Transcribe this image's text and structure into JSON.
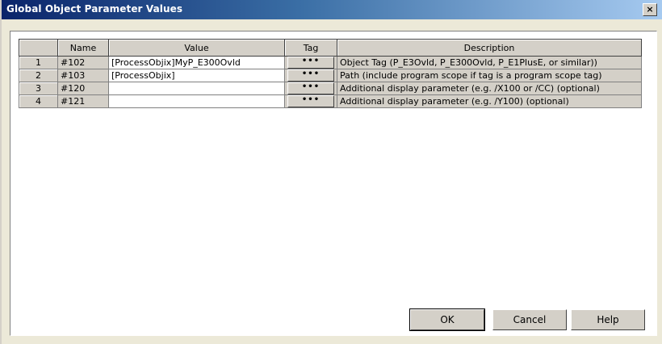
{
  "window": {
    "title": "Global Object Parameter Values",
    "close_label": "×"
  },
  "table": {
    "headers": {
      "rownum": "",
      "name": "Name",
      "value": "Value",
      "tag": "Tag",
      "description": "Description"
    },
    "rows": [
      {
        "num": "1",
        "name": "#102",
        "value": "[ProcessObjix]MyP_E300Ovld",
        "tag": "•••",
        "description": "Object Tag (P_E3Ovld, P_E300Ovld, P_E1PlusE, or similar))"
      },
      {
        "num": "2",
        "name": "#103",
        "value": "[ProcessObjix]",
        "tag": "•••",
        "description": "Path (include program scope if tag is a program scope tag)"
      },
      {
        "num": "3",
        "name": "#120",
        "value": "",
        "tag": "•••",
        "description": "Additional display parameter (e.g. /X100 or /CC) (optional)"
      },
      {
        "num": "4",
        "name": "#121",
        "value": "",
        "tag": "•••",
        "description": "Additional display parameter (e.g. /Y100) (optional)"
      }
    ]
  },
  "buttons": {
    "ok": "OK",
    "cancel": "Cancel",
    "help": "Help"
  }
}
